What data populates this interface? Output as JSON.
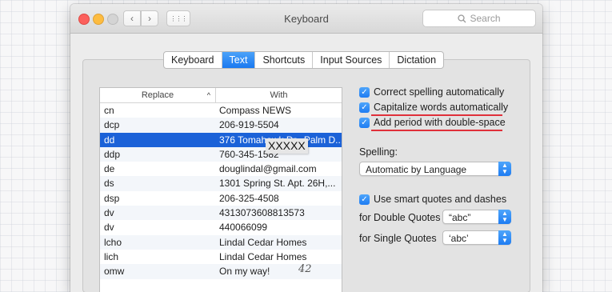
{
  "window": {
    "title": "Keyboard"
  },
  "toolbar": {
    "back_icon": "‹",
    "forward_icon": "›",
    "grid_icon": "⋮⋮⋮"
  },
  "search": {
    "placeholder": "Search",
    "icon": "search-icon"
  },
  "tabs": [
    {
      "label": "Keyboard",
      "active": false
    },
    {
      "label": "Text",
      "active": true
    },
    {
      "label": "Shortcuts",
      "active": false
    },
    {
      "label": "Input Sources",
      "active": false
    },
    {
      "label": "Dictation",
      "active": false
    }
  ],
  "table": {
    "col_replace": "Replace",
    "col_with": "With",
    "rows": [
      {
        "replace": "cn",
        "with": "Compass NEWS"
      },
      {
        "replace": "dcp",
        "with": "206-919-5504"
      },
      {
        "replace": "dd",
        "with": "376 Tomahawk Dr., Palm D...",
        "selected": true
      },
      {
        "replace": "ddp",
        "with": "760-345-1582"
      },
      {
        "replace": "de",
        "with": "douglindal@gmail.com"
      },
      {
        "replace": "ds",
        "with": "1301 Spring St. Apt. 26H,..."
      },
      {
        "replace": "dsp",
        "with": "206-325-4508"
      },
      {
        "replace": "dv",
        "with": "4313073608813573"
      },
      {
        "replace": "dv",
        "with": "440066099"
      },
      {
        "replace": "lcho",
        "with": "Lindal Cedar Homes"
      },
      {
        "replace": "lich",
        "with": "Lindal Cedar Homes"
      },
      {
        "replace": "omw",
        "with": "On my way!"
      }
    ]
  },
  "annotations": {
    "redaction": "XXXXX",
    "handwritten_number": "42"
  },
  "options": {
    "correct_spelling": "Correct spelling automatically",
    "capitalize_words": "Capitalize words automatically",
    "add_period": "Add period with double-space",
    "spelling_label": "Spelling:",
    "spelling_value": "Automatic by Language",
    "smart_quotes": "Use smart quotes and dashes",
    "double_quotes_label": "for Double Quotes",
    "double_quotes_value": "“abc”",
    "single_quotes_label": "for Single Quotes",
    "single_quotes_value": "‘abc’"
  },
  "colors": {
    "accent": "#1e7cf2",
    "selection": "#1b62d8",
    "underline": "#e0303a"
  }
}
